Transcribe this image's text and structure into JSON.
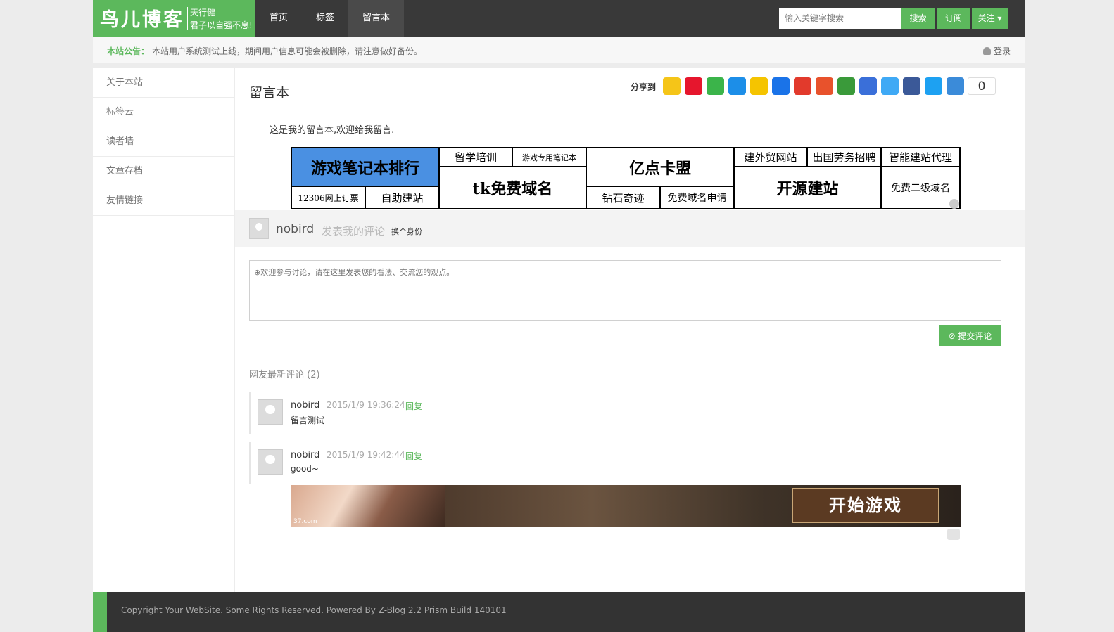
{
  "header": {
    "logo_main": "鸟儿博客",
    "logo_sub1": "天行健",
    "logo_sub2": "君子以自强不息!",
    "nav": [
      "首页",
      "标签",
      "留言本"
    ],
    "search_placeholder": "输入关键字搜索",
    "search_button": "搜索",
    "subscribe": "订阅",
    "follow": "关注 ▾"
  },
  "notice": {
    "label": "本站公告：",
    "text": "本站用户系统测试上线，期间用户信息可能会被删除，请注意做好备份。",
    "login": "登录"
  },
  "sidebar": [
    "关于本站",
    "标签云",
    "读者墙",
    "文章存档",
    "友情链接"
  ],
  "page": {
    "title": "留言本",
    "share_label": "分享到",
    "share_count": "0",
    "intro": "这是我的留言本,欢迎给我留言."
  },
  "share_colors": [
    "#f5c518",
    "#e6162d",
    "#3bb44a",
    "#1c8ee8",
    "#f5c400",
    "#1a73e8",
    "#e23a2c",
    "#e8522c",
    "#3a9a3a",
    "#3a6fd9",
    "#3fa9f5",
    "#3b5998",
    "#1da1f2",
    "#3b8bd9"
  ],
  "ad_links": {
    "a1": "游戏笔记本排行",
    "a2": "留学培训",
    "a3": "游戏专用笔记本",
    "a4": "亿点卡盟",
    "a5": "建外贸网站",
    "a6": "出国劳务招聘",
    "a7": "智能建站代理",
    "a8": "12306网上订票",
    "a9": "自助建站",
    "a10": "tk免费域名",
    "a11": "钻石奇迹",
    "a12": "免费域名申请",
    "a13": "开源建站",
    "a14": "免费二级域名"
  },
  "comment_form": {
    "user": "nobird",
    "post_label": "发表我的评论",
    "switch_identity": "换个身份",
    "placeholder": "⊕欢迎参与讨论，请在这里发表您的看法、交流您的观点。",
    "submit": "⊘ 提交评论"
  },
  "comments_title": "网友最新评论 (2)",
  "comments": [
    {
      "author": "nobird",
      "time": "2015/1/9 19:36:24",
      "reply": "回复",
      "body": "留言测试"
    },
    {
      "author": "nobird",
      "time": "2015/1/9 19:42:44",
      "reply": "回复",
      "body": "good~"
    }
  ],
  "game_ad": {
    "button": "开始游戏",
    "brand": "37.com"
  },
  "footer": "Copyright Your WebSite. Some Rights Reserved.   Powered By Z-Blog 2.2 Prism Build 140101"
}
